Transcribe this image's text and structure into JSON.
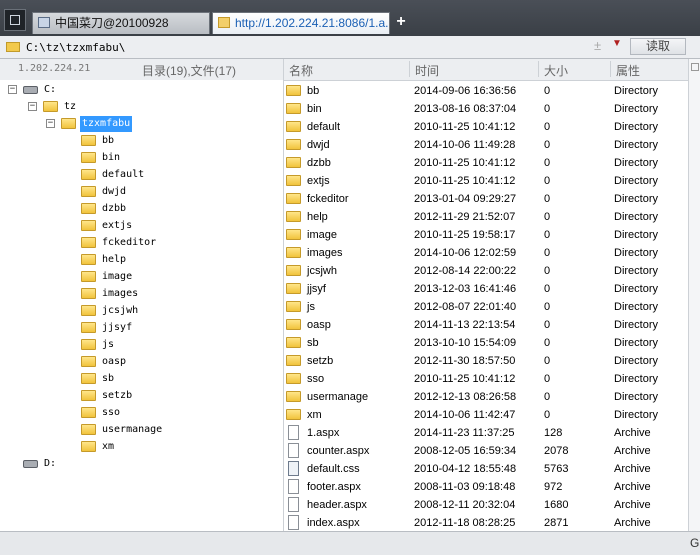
{
  "tabs": [
    {
      "label": "中国菜刀@20100928",
      "active": false
    },
    {
      "label": "http://1.202.224.21:8086/1.a...",
      "active": true
    }
  ],
  "new_tab_symbol": "+",
  "address": {
    "value": "C:\\tz\\tzxmfabu\\",
    "plus": "±",
    "dropdown": "▼",
    "read_button": "读取"
  },
  "left_header": {
    "server": "1.202.224.21",
    "counts": "目录(19),文件(17)"
  },
  "tree": {
    "drive_c": "C:",
    "tz": "tz",
    "tzxmfabu": "tzxmfabu",
    "children": [
      "bb",
      "bin",
      "default",
      "dwjd",
      "dzbb",
      "extjs",
      "fckeditor",
      "help",
      "image",
      "images",
      "jcsjwh",
      "jjsyf",
      "js",
      "oasp",
      "sb",
      "setzb",
      "sso",
      "usermanage",
      "xm"
    ],
    "drive_d": "D:",
    "expander_minus": "−",
    "expander_plus": "+"
  },
  "columns": {
    "name": "名称",
    "time": "时间",
    "size": "大小",
    "attr": "属性"
  },
  "files": [
    {
      "name": "bb",
      "time": "2014-09-06 16:36:56",
      "size": "0",
      "attr": "Directory",
      "icon": "folder"
    },
    {
      "name": "bin",
      "time": "2013-08-16 08:37:04",
      "size": "0",
      "attr": "Directory",
      "icon": "folder"
    },
    {
      "name": "default",
      "time": "2010-11-25 10:41:12",
      "size": "0",
      "attr": "Directory",
      "icon": "folder"
    },
    {
      "name": "dwjd",
      "time": "2014-10-06 11:49:28",
      "size": "0",
      "attr": "Directory",
      "icon": "folder"
    },
    {
      "name": "dzbb",
      "time": "2010-11-25 10:41:12",
      "size": "0",
      "attr": "Directory",
      "icon": "folder"
    },
    {
      "name": "extjs",
      "time": "2010-11-25 10:41:12",
      "size": "0",
      "attr": "Directory",
      "icon": "folder"
    },
    {
      "name": "fckeditor",
      "time": "2013-01-04 09:29:27",
      "size": "0",
      "attr": "Directory",
      "icon": "folder"
    },
    {
      "name": "help",
      "time": "2012-11-29 21:52:07",
      "size": "0",
      "attr": "Directory",
      "icon": "folder"
    },
    {
      "name": "image",
      "time": "2010-11-25 19:58:17",
      "size": "0",
      "attr": "Directory",
      "icon": "folder"
    },
    {
      "name": "images",
      "time": "2014-10-06 12:02:59",
      "size": "0",
      "attr": "Directory",
      "icon": "folder"
    },
    {
      "name": "jcsjwh",
      "time": "2012-08-14 22:00:22",
      "size": "0",
      "attr": "Directory",
      "icon": "folder"
    },
    {
      "name": "jjsyf",
      "time": "2013-12-03 16:41:46",
      "size": "0",
      "attr": "Directory",
      "icon": "folder"
    },
    {
      "name": "js",
      "time": "2012-08-07 22:01:40",
      "size": "0",
      "attr": "Directory",
      "icon": "folder"
    },
    {
      "name": "oasp",
      "time": "2014-11-13 22:13:54",
      "size": "0",
      "attr": "Directory",
      "icon": "folder"
    },
    {
      "name": "sb",
      "time": "2013-10-10 15:54:09",
      "size": "0",
      "attr": "Directory",
      "icon": "folder"
    },
    {
      "name": "setzb",
      "time": "2012-11-30 18:57:50",
      "size": "0",
      "attr": "Directory",
      "icon": "folder"
    },
    {
      "name": "sso",
      "time": "2010-11-25 10:41:12",
      "size": "0",
      "attr": "Directory",
      "icon": "folder"
    },
    {
      "name": "usermanage",
      "time": "2012-12-13 08:26:58",
      "size": "0",
      "attr": "Directory",
      "icon": "folder"
    },
    {
      "name": "xm",
      "time": "2014-10-06 11:42:47",
      "size": "0",
      "attr": "Directory",
      "icon": "folder"
    },
    {
      "name": "1.aspx",
      "time": "2014-11-23 11:37:25",
      "size": "128",
      "attr": "Archive",
      "icon": "file"
    },
    {
      "name": "counter.aspx",
      "time": "2008-12-05 16:59:34",
      "size": "2078",
      "attr": "Archive",
      "icon": "file"
    },
    {
      "name": "default.css",
      "time": "2010-04-12 18:55:48",
      "size": "5763",
      "attr": "Archive",
      "icon": "cssfile"
    },
    {
      "name": "footer.aspx",
      "time": "2008-11-03 09:18:48",
      "size": "972",
      "attr": "Archive",
      "icon": "file"
    },
    {
      "name": "header.aspx",
      "time": "2008-12-11 20:32:04",
      "size": "1680",
      "attr": "Archive",
      "icon": "file"
    },
    {
      "name": "index.aspx",
      "time": "2012-11-18 08:28:25",
      "size": "2871",
      "attr": "Archive",
      "icon": "file"
    }
  ],
  "status": {
    "text": "G"
  }
}
